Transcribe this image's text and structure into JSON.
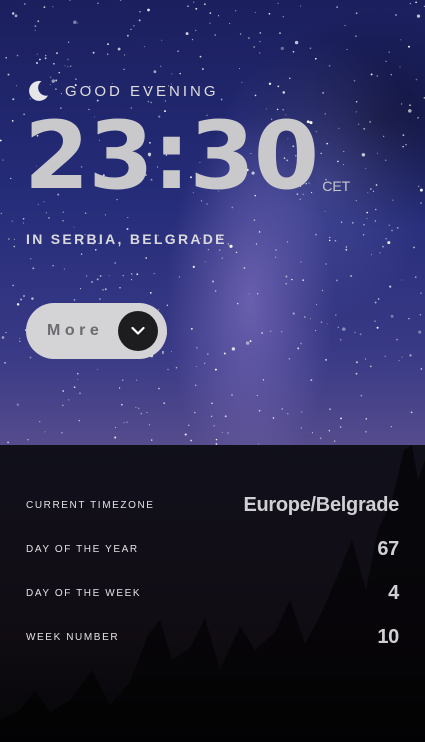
{
  "greeting": "GOOD EVENING",
  "time": {
    "value": "23:30",
    "abbreviation": "CET"
  },
  "location": "IN SERBIA, BELGRADE",
  "more_button": {
    "label": "More"
  },
  "details": [
    {
      "label": "CURRENT TIMEZONE",
      "value": "Europe/Belgrade"
    },
    {
      "label": "DAY OF THE YEAR",
      "value": "67"
    },
    {
      "label": "DAY OF THE WEEK",
      "value": "4"
    },
    {
      "label": "WEEK NUMBER",
      "value": "10"
    }
  ],
  "icons": {
    "greeting_icon": "moon-icon",
    "more_icon": "chevron-down-icon"
  },
  "colors": {
    "button_bg": "#d4d4d7",
    "button_circle": "#1d1d1f",
    "text_light": "#d0d0d4"
  }
}
